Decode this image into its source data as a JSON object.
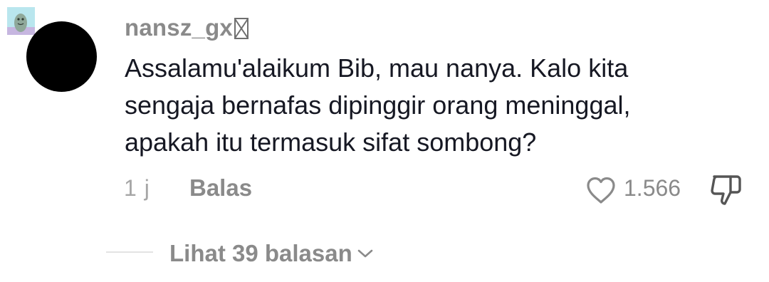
{
  "comment": {
    "username": "nansz_gx",
    "text": "Assalamu'alaikum Bib, mau nanya. Kalo kita\nsengaja bernafas dipinggir orang meninggal,\napakah itu termasuk sifat sombong?",
    "time": "1 j",
    "reply_label": "Balas",
    "like_count": "1.566",
    "view_replies_label": "Lihat 39 balasan"
  },
  "icons": {
    "like": "heart-outline-icon",
    "dislike": "thumbs-down-icon",
    "expand": "chevron-down-icon",
    "username_glyph": "missing-glyph-icon"
  },
  "colors": {
    "avatar": "#000000",
    "username": "#8a8a8a",
    "text": "#161823",
    "meta": "#a6a6a6",
    "thumbnail_bg": "#b9e6ee"
  }
}
